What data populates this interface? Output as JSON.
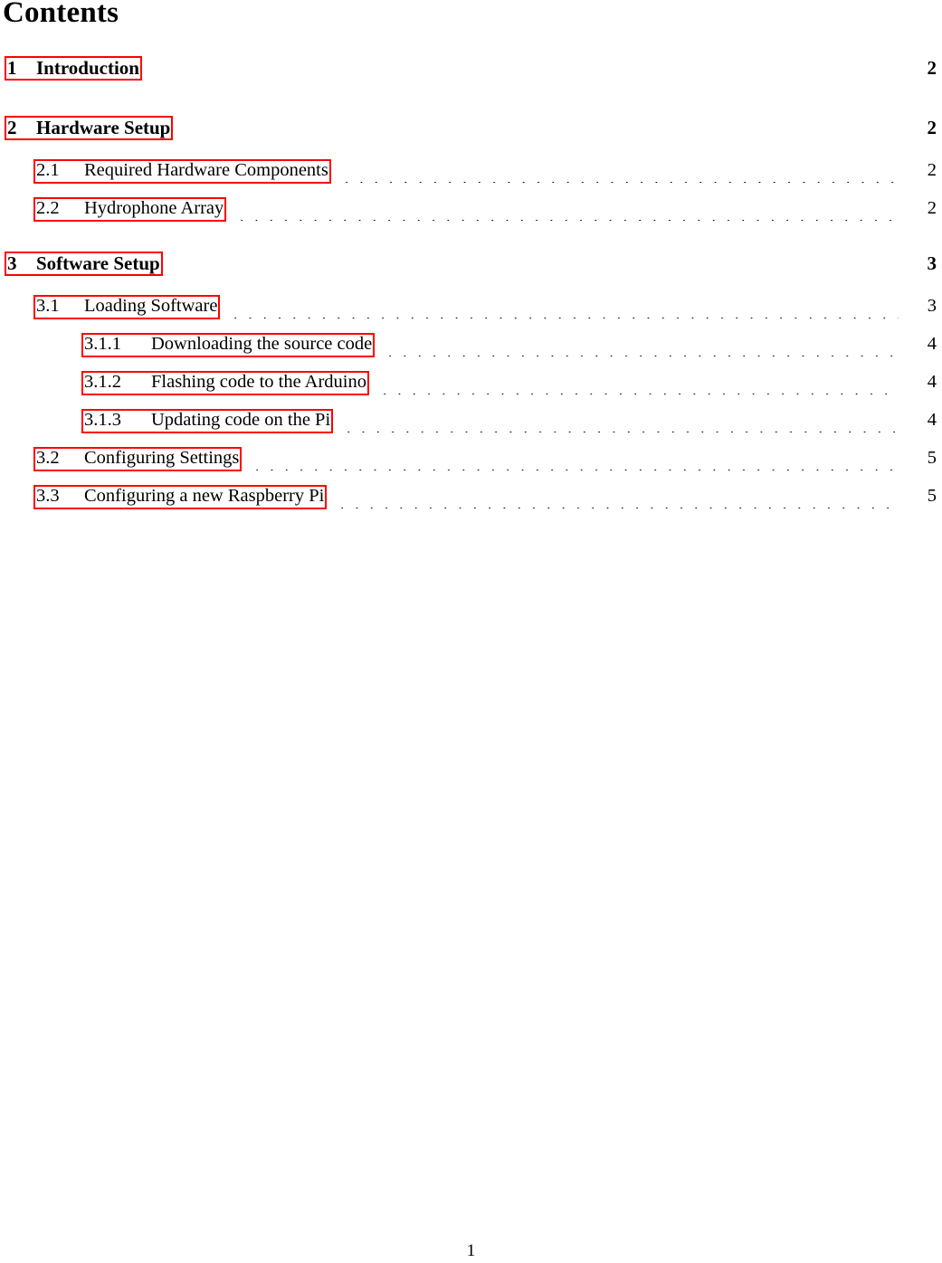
{
  "document": {
    "heading": "Contents",
    "folio": "1",
    "link_box_color": "#ff0000",
    "text_color": "#000000",
    "background_color": "#ffffff"
  },
  "toc": {
    "entries": [
      {
        "level": "section",
        "number": "1",
        "title": "Introduction",
        "page": "2",
        "leader": false
      },
      {
        "level": "section",
        "number": "2",
        "title": "Hardware Setup",
        "page": "2",
        "leader": false
      },
      {
        "level": "subsection",
        "number": "2.1",
        "title": "Required Hardware Components",
        "page": "2",
        "leader": true
      },
      {
        "level": "subsection",
        "number": "2.2",
        "title": "Hydrophone Array",
        "page": "2",
        "leader": true
      },
      {
        "level": "section",
        "number": "3",
        "title": "Software Setup",
        "page": "3",
        "leader": false
      },
      {
        "level": "subsection",
        "number": "3.1",
        "title": "Loading Software",
        "page": "3",
        "leader": true
      },
      {
        "level": "subsubsection",
        "number": "3.1.1",
        "title": "Downloading the source code",
        "page": "4",
        "leader": true
      },
      {
        "level": "subsubsection",
        "number": "3.1.2",
        "title": "Flashing code to the Arduino",
        "page": "4",
        "leader": true
      },
      {
        "level": "subsubsection",
        "number": "3.1.3",
        "title": "Updating code on the Pi",
        "page": "4",
        "leader": true
      },
      {
        "level": "subsection",
        "number": "3.2",
        "title": "Configuring Settings",
        "page": "5",
        "leader": true
      },
      {
        "level": "subsection",
        "number": "3.3",
        "title": "Configuring a new Raspberry Pi",
        "page": "5",
        "leader": true
      }
    ]
  }
}
